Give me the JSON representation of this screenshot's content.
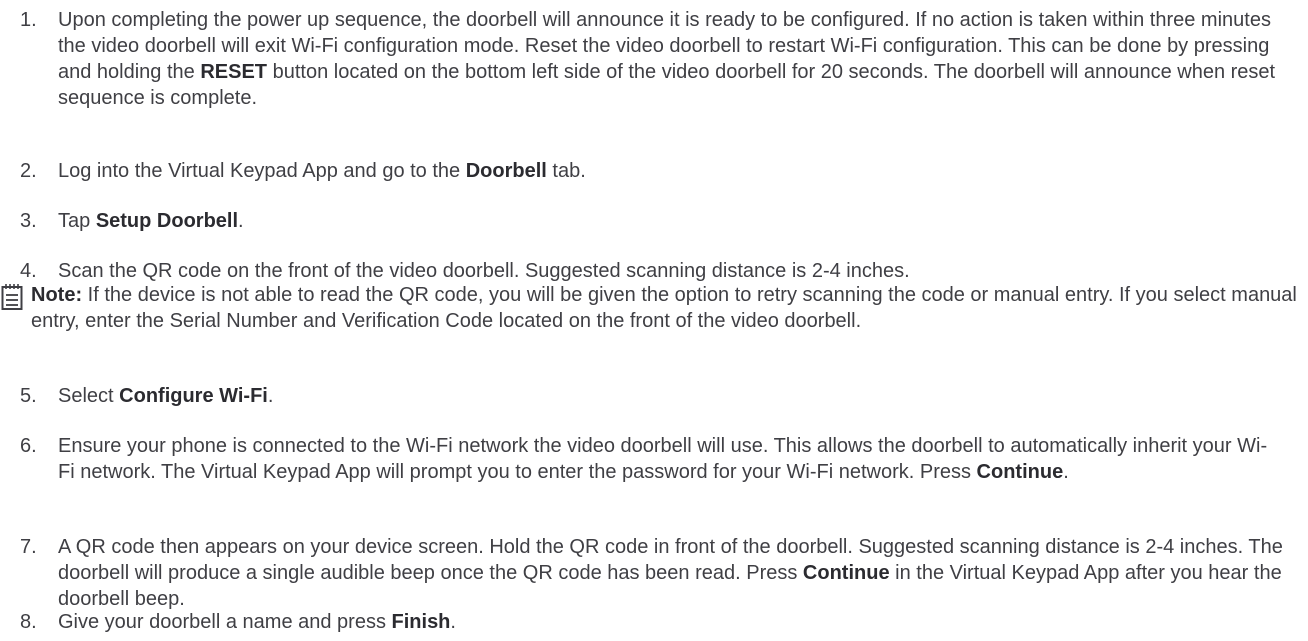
{
  "steps": [
    {
      "number": "1.",
      "parts": [
        {
          "t": "Upon completing the power up sequence, the doorbell will announce it is ready to be configured. If no action is taken within three minutes the video doorbell will exit Wi-Fi configuration mode. Reset the video doorbell to restart Wi-Fi configuration. This can be done by pressing and holding the ",
          "b": false
        },
        {
          "t": "RESET",
          "b": true
        },
        {
          "t": " button located on the bottom left side of the video doorbell for 20 seconds. The doorbell will announce when reset sequence is complete.",
          "b": false
        }
      ]
    },
    {
      "number": "2.",
      "parts": [
        {
          "t": "Log into the Virtual Keypad App and go to the ",
          "b": false
        },
        {
          "t": "Doorbell",
          "b": true
        },
        {
          "t": " tab.",
          "b": false
        }
      ]
    },
    {
      "number": "3.",
      "parts": [
        {
          "t": "Tap ",
          "b": false
        },
        {
          "t": "Setup Doorbell",
          "b": true
        },
        {
          "t": ".",
          "b": false
        }
      ]
    },
    {
      "number": "4.",
      "parts": [
        {
          "t": "Scan the QR code on the front of the video doorbell. Suggested scanning distance is 2-4 inches.",
          "b": false
        }
      ]
    },
    {
      "number": "5.",
      "parts": [
        {
          "t": "Select ",
          "b": false
        },
        {
          "t": "Configure Wi-Fi",
          "b": true
        },
        {
          "t": ".",
          "b": false
        }
      ]
    },
    {
      "number": "6.",
      "parts": [
        {
          "t": "Ensure your phone is connected to the Wi-Fi network the video doorbell will use. This allows the doorbell to automatically inherit your Wi-Fi network. The Virtual Keypad App will prompt you to enter the password for your Wi-Fi network. Press ",
          "b": false
        },
        {
          "t": "Continue",
          "b": true
        },
        {
          "t": ".",
          "b": false
        }
      ]
    },
    {
      "number": "7.",
      "parts": [
        {
          "t": "A QR code then appears on your device screen. Hold the QR code in front of the doorbell. Suggested scanning distance is 2-4 inches. The doorbell will produce a single audible beep once the QR code has been read. Press ",
          "b": false
        },
        {
          "t": "Continue",
          "b": true
        },
        {
          "t": " in the Virtual Keypad App after you hear the doorbell beep.",
          "b": false
        }
      ]
    },
    {
      "number": "8.",
      "parts": [
        {
          "t": "Give your doorbell a name and press ",
          "b": false
        },
        {
          "t": "Finish",
          "b": true
        },
        {
          "t": ".",
          "b": false
        }
      ]
    }
  ],
  "note": {
    "icon": "note-icon",
    "label": "Note:",
    "text": " If the device is not able to read the QR code, you will be given the option to retry scanning the code or manual entry. If you select manual entry, enter the Serial Number and Verification Code located on the front of the video doorbell."
  }
}
